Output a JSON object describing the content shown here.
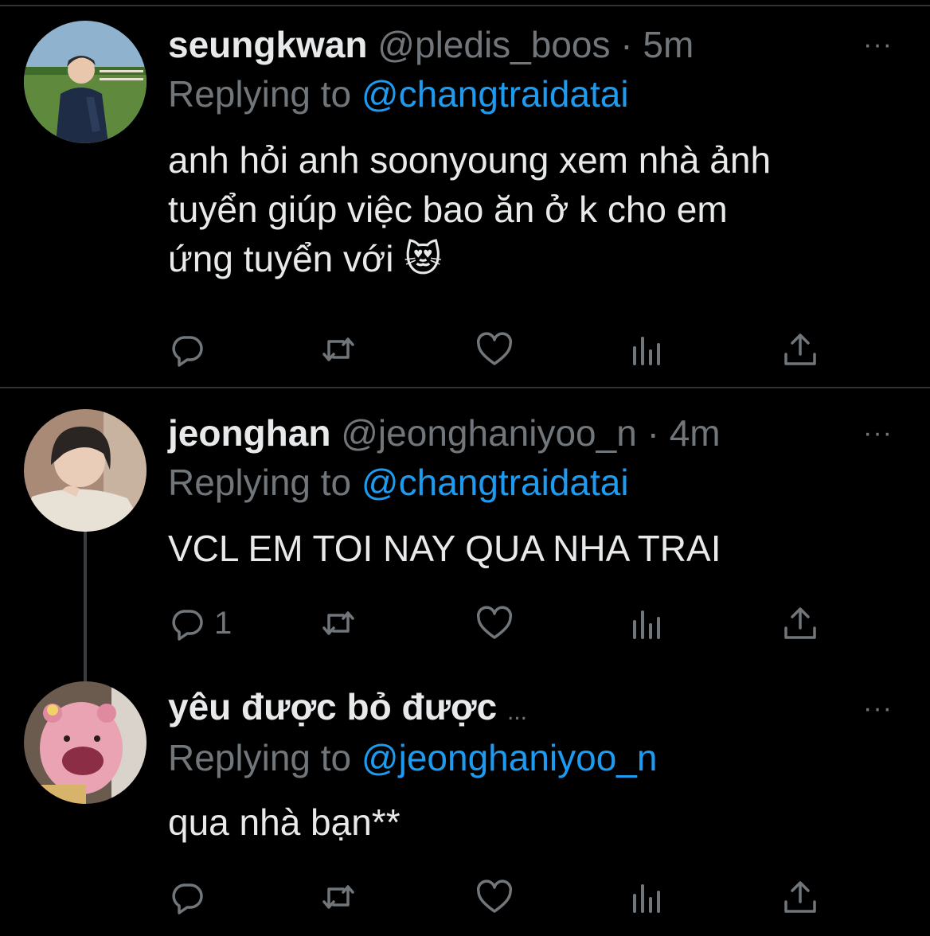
{
  "tweets": [
    {
      "name": "seungkwan",
      "handle": "@pledis_boos",
      "dot": "·",
      "time": "5m",
      "reply_prefix": "Replying to ",
      "reply_to": "@changtraidatai",
      "lines": [
        "anh hỏi anh soonyoung xem nhà ảnh",
        "tuyển giúp việc bao ăn ở k cho em",
        "ứng tuyển với 😻"
      ],
      "more": "···",
      "reply_count": ""
    },
    {
      "name": "jeonghan",
      "handle": "@jeonghaniyoo_n",
      "dot": "·",
      "time": "4m",
      "reply_prefix": "Replying to ",
      "reply_to": "@changtraidatai",
      "lines": [
        "VCL EM TOI NAY QUA NHA TRAI"
      ],
      "more": "···",
      "reply_count": "1"
    },
    {
      "name": "yêu được bỏ được",
      "truncation": "...",
      "reply_prefix": "Replying to ",
      "reply_to": "@jeonghaniyoo_n",
      "lines": [
        "qua nhà bạn**"
      ],
      "more": "···",
      "reply_count": ""
    }
  ],
  "icons": [
    "reply-icon",
    "retweet-icon",
    "like-icon",
    "analytics-icon",
    "share-icon"
  ],
  "colors": {
    "background": "#000000",
    "text": "#e7e9ea",
    "muted": "#71767b",
    "link": "#1d9bf0"
  }
}
